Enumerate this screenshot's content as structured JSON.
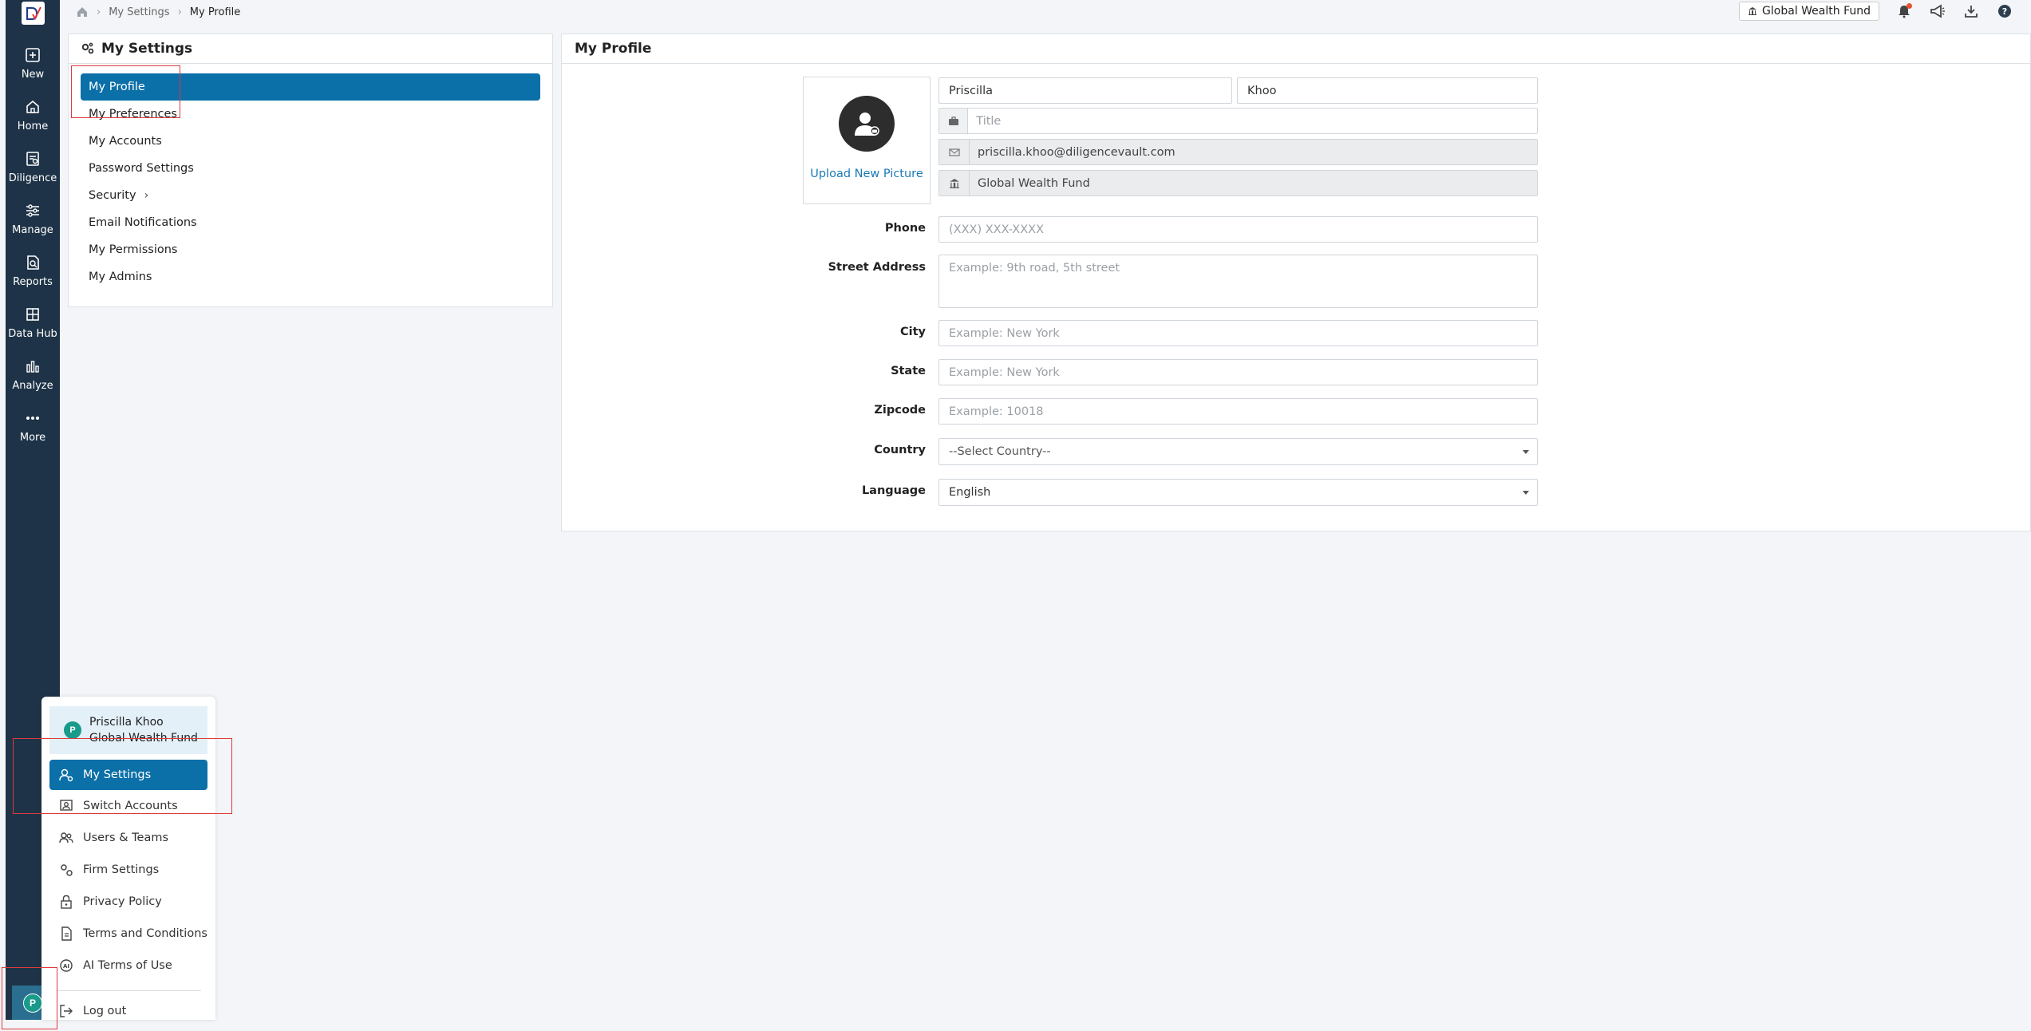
{
  "nav": {
    "items": [
      {
        "label": "New",
        "icon": "plus-square-icon"
      },
      {
        "label": "Home",
        "icon": "home-icon"
      },
      {
        "label": "Diligence",
        "icon": "diligence-icon"
      },
      {
        "label": "Manage",
        "icon": "manage-icon"
      },
      {
        "label": "Reports",
        "icon": "reports-icon"
      },
      {
        "label": "Data Hub",
        "icon": "grid-icon"
      },
      {
        "label": "Analyze",
        "icon": "bar-chart-icon"
      },
      {
        "label": "More",
        "icon": "more-dots-icon"
      }
    ],
    "avatar_initial": "P"
  },
  "breadcrumb": {
    "level1": "My Settings",
    "current": "My Profile"
  },
  "topbar": {
    "fund_name": "Global Wealth Fund"
  },
  "settings": {
    "title": "My Settings",
    "items": [
      {
        "label": "My Profile",
        "active": true
      },
      {
        "label": "My Preferences"
      },
      {
        "label": "My Accounts"
      },
      {
        "label": "Password Settings"
      },
      {
        "label": "Security"
      },
      {
        "label": "Email Notifications"
      },
      {
        "label": "My Permissions"
      },
      {
        "label": "My Admins"
      }
    ]
  },
  "profile": {
    "title": "My Profile",
    "upload_label": "Upload New Picture",
    "first_name": "Priscilla",
    "last_name": "Khoo",
    "title_placeholder": "Title",
    "email": "priscilla.khoo@diligencevault.com",
    "firm": "Global Wealth Fund",
    "labels": {
      "phone": "Phone",
      "street": "Street Address",
      "city": "City",
      "state": "State",
      "zipcode": "Zipcode",
      "country": "Country",
      "language": "Language"
    },
    "placeholders": {
      "phone": "(XXX) XXX-XXXX",
      "street": "Example: 9th road, 5th street",
      "city": "Example: New York",
      "state": "Example: New York",
      "zipcode": "Example: 10018"
    },
    "country_value": "--Select Country--",
    "language_value": "English"
  },
  "account_menu": {
    "user_name": "Priscilla Khoo",
    "user_firm": "Global Wealth Fund",
    "avatar_initial": "P",
    "items": [
      {
        "label": "My Settings",
        "icon": "user-settings-icon",
        "active": true
      },
      {
        "label": "Switch Accounts",
        "icon": "switch-accounts-icon"
      },
      {
        "label": "Users & Teams",
        "icon": "users-icon"
      },
      {
        "label": "Firm Settings",
        "icon": "gears-icon"
      },
      {
        "label": "Privacy Policy",
        "icon": "lock-icon"
      },
      {
        "label": "Terms and Conditions",
        "icon": "document-icon"
      },
      {
        "label": "AI Terms of Use",
        "icon": "ai-icon"
      },
      {
        "label": "Log out",
        "icon": "logout-icon"
      }
    ]
  },
  "colors": {
    "nav_bg": "#1e3347",
    "accent": "#0b6fa8",
    "annotation": "#e0393e"
  }
}
